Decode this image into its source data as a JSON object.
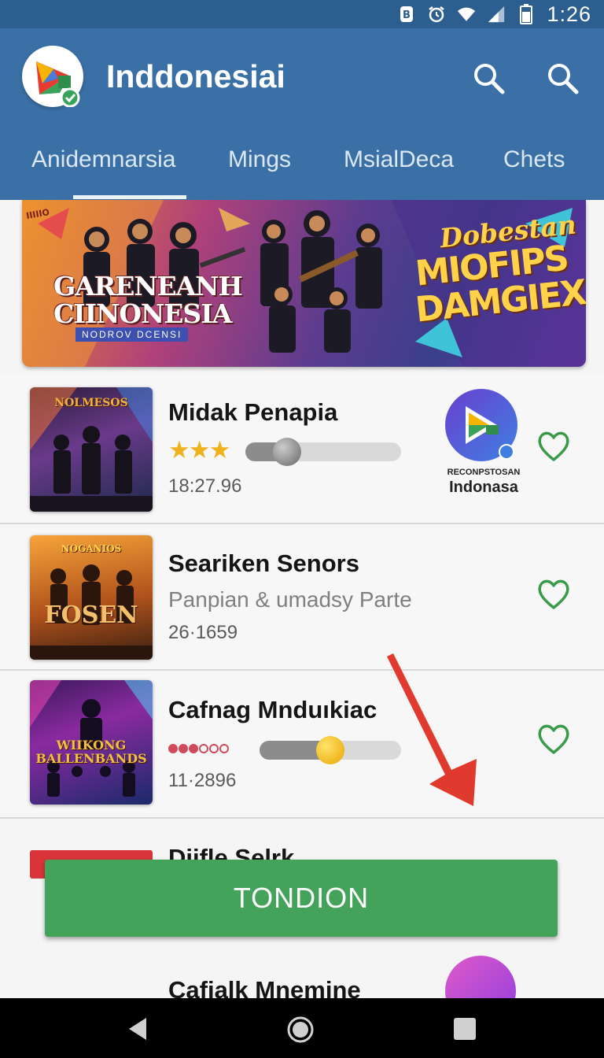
{
  "status_bar": {
    "time": "1:26",
    "icons": [
      "notification-icon",
      "alarm-icon",
      "wifi-icon",
      "signal-icon",
      "battery-icon"
    ]
  },
  "app_bar": {
    "title": "Inddonesiai",
    "actions": [
      "search-icon",
      "search-icon"
    ]
  },
  "tabs": [
    {
      "label": "Anidemnarsia",
      "selected": true
    },
    {
      "label": "Mings",
      "selected": false
    },
    {
      "label": "MsialDeca",
      "selected": false
    },
    {
      "label": "Chets",
      "selected": false
    }
  ],
  "banner": {
    "corner_text": "IIIIIO",
    "title_line1": "GARENEANH",
    "title_line2": "CIINONESIA",
    "subtitle": "NODROV DCENSI",
    "right_line1": "Dobestan",
    "right_line2": "MIOFIPS",
    "right_line3": "DAMGIEX"
  },
  "list": [
    {
      "title": "Midak Penapia",
      "meta": "18:27.96",
      "thumb_label": "NOLMESOS",
      "rating_stars": 3,
      "progress": 0.27,
      "badge_caption_small": "RECONPSTOSAN",
      "badge_caption": "Indonasa"
    },
    {
      "title": "Seariken Senors",
      "subtitle": "Panpian & umadsy Parte",
      "meta": "26·1659",
      "thumb_label_top": "NOGANIOS",
      "thumb_label": "FOSEN"
    },
    {
      "title": "Cafnag Mnduıkiac",
      "meta": "11·2896",
      "thumb_label": "WIIKONG BALLENBANDS",
      "dots_filled": 3,
      "dots_total": 6,
      "progress": 0.5
    }
  ],
  "peek_titles": [
    "Diifle Selrk",
    "Cafialk Mnemine"
  ],
  "cta": {
    "label": "TONDION"
  },
  "colors": {
    "primary": "#3a70a6",
    "status_bar": "#2c5f8f",
    "accent_green": "#43a35a",
    "heart_green": "#3a9a48",
    "arrow_red": "#e03a2e",
    "star": "#f0b21c"
  }
}
